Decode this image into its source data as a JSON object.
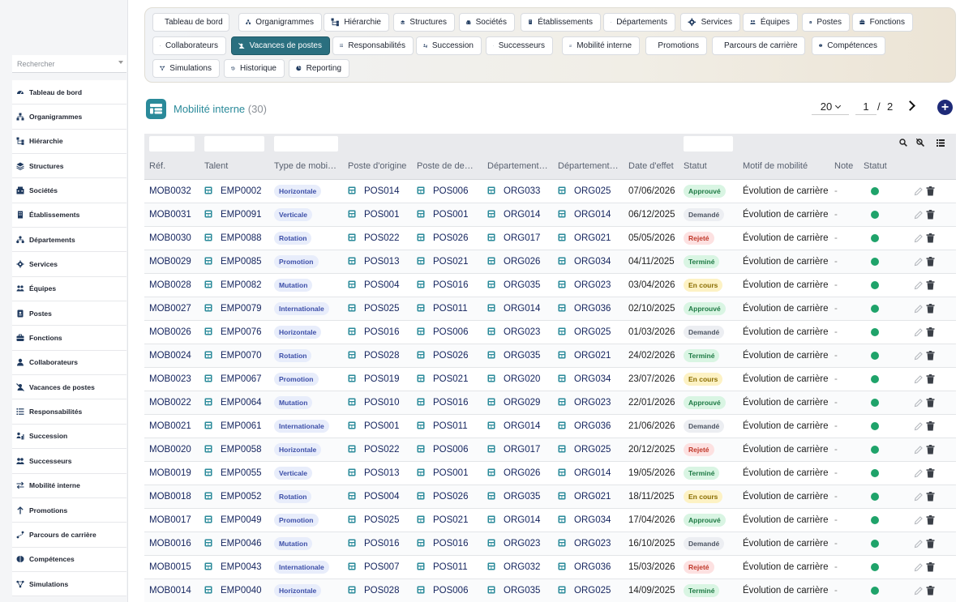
{
  "sidebar": {
    "search_placeholder": "Rechercher",
    "items": [
      {
        "label": "Tableau de bord",
        "icon": "dashboard-icon"
      },
      {
        "label": "Organigrammes",
        "icon": "org-chart-icon"
      },
      {
        "label": "Hiérarchie",
        "icon": "hierarchy-icon"
      },
      {
        "label": "Structures",
        "icon": "layers-icon"
      },
      {
        "label": "Sociétés",
        "icon": "company-icon"
      },
      {
        "label": "Établissements",
        "icon": "building-icon"
      },
      {
        "label": "Départements",
        "icon": "departments-icon"
      },
      {
        "label": "Services",
        "icon": "services-icon"
      },
      {
        "label": "Équipes",
        "icon": "teams-icon"
      },
      {
        "label": "Postes",
        "icon": "badge-icon"
      },
      {
        "label": "Fonctions",
        "icon": "briefcase-icon"
      },
      {
        "label": "Collaborateurs",
        "icon": "user-icon"
      },
      {
        "label": "Vacances de postes",
        "icon": "vacancy-icon"
      },
      {
        "label": "Responsabilités",
        "icon": "list-icon"
      },
      {
        "label": "Succession",
        "icon": "succession-icon"
      },
      {
        "label": "Successeurs",
        "icon": "successors-icon"
      },
      {
        "label": "Mobilité interne",
        "icon": "swap-icon"
      },
      {
        "label": "Promotions",
        "icon": "arrow-up-icon"
      },
      {
        "label": "Parcours de carrière",
        "icon": "career-path-icon"
      },
      {
        "label": "Compétences",
        "icon": "brain-icon"
      },
      {
        "label": "Simulations",
        "icon": "simulation-icon"
      }
    ]
  },
  "menu": {
    "active_index": 12,
    "rows": [
      [
        {
          "label": "Tableau de bord",
          "icon": "dashboard-icon"
        },
        {
          "label": "Organigrammes",
          "icon": "org-chart-icon"
        },
        {
          "label": "Hiérarchie",
          "icon": "hierarchy-icon"
        },
        {
          "label": "Structures",
          "icon": "layers-icon"
        },
        {
          "label": "Sociétés",
          "icon": "company-icon"
        },
        {
          "label": "Établissements",
          "icon": "building-icon"
        },
        {
          "label": "Départements",
          "icon": "departments-icon"
        },
        {
          "label": "Services",
          "icon": "services-icon"
        },
        {
          "label": "Équipes",
          "icon": "teams-icon"
        },
        {
          "label": "Postes",
          "icon": "badge-icon"
        },
        {
          "label": "Fonctions",
          "icon": "briefcase-icon"
        }
      ],
      [
        {
          "label": "Collaborateurs",
          "icon": "user-icon"
        },
        {
          "label": "Vacances de postes",
          "icon": "vacancy-icon"
        },
        {
          "label": "Responsabilités",
          "icon": "list-icon"
        },
        {
          "label": "Succession",
          "icon": "succession-icon"
        },
        {
          "label": "Successeurs",
          "icon": "successors-icon"
        },
        {
          "label": "Mobilité interne",
          "icon": "swap-icon"
        },
        {
          "label": "Promotions",
          "icon": "arrow-up-icon"
        },
        {
          "label": "Parcours de carrière",
          "icon": "career-path-icon"
        },
        {
          "label": "Compétences",
          "icon": "brain-icon"
        }
      ],
      [
        {
          "label": "Simulations",
          "icon": "simulation-icon"
        },
        {
          "label": "Historique",
          "icon": "history-icon"
        },
        {
          "label": "Reporting",
          "icon": "chart-icon"
        }
      ]
    ]
  },
  "header": {
    "title": "Mobilité interne",
    "count": "(30)",
    "page_size": "20",
    "page_current": "1",
    "page_separator": "/",
    "page_total": "2"
  },
  "table": {
    "columns": [
      "Réf.",
      "Talent",
      "Type de mobi…",
      "Poste d'origine",
      "Poste de de…",
      "Département…",
      "Département…",
      "Date d'effet",
      "Statut",
      "Motif de mobilité",
      "Note",
      "Statut"
    ],
    "colors": {
      "Approuvé": {
        "bg": "#d9f5e3",
        "fg": "#1f7a45"
      },
      "Demandé": {
        "bg": "#eceef2",
        "fg": "#4d5563"
      },
      "Rejeté": {
        "bg": "#fde1e1",
        "fg": "#c0392b"
      },
      "Terminé": {
        "bg": "#d9f5e3",
        "fg": "#1f7a45"
      },
      "En cours": {
        "bg": "#fdf2c4",
        "fg": "#8a6d00"
      },
      "active_dot": "#1fa36a"
    },
    "rows": [
      {
        "ref": "MOB0032",
        "talent": "EMP0002",
        "type": "Horizontale",
        "origin": "POS014",
        "dest": "POS006",
        "dep_from": "ORG033",
        "dep_to": "ORG025",
        "date": "07/06/2026",
        "status": "Approuvé",
        "reason": "Évolution de carrière",
        "note": "-"
      },
      {
        "ref": "MOB0031",
        "talent": "EMP0091",
        "type": "Verticale",
        "origin": "POS001",
        "dest": "POS001",
        "dep_from": "ORG014",
        "dep_to": "ORG014",
        "date": "06/12/2025",
        "status": "Demandé",
        "reason": "Évolution de carrière",
        "note": "-"
      },
      {
        "ref": "MOB0030",
        "talent": "EMP0088",
        "type": "Rotation",
        "origin": "POS022",
        "dest": "POS026",
        "dep_from": "ORG017",
        "dep_to": "ORG021",
        "date": "05/05/2026",
        "status": "Rejeté",
        "reason": "Évolution de carrière",
        "note": "-"
      },
      {
        "ref": "MOB0029",
        "talent": "EMP0085",
        "type": "Promotion",
        "origin": "POS013",
        "dest": "POS021",
        "dep_from": "ORG026",
        "dep_to": "ORG034",
        "date": "04/11/2025",
        "status": "Terminé",
        "reason": "Évolution de carrière",
        "note": "-"
      },
      {
        "ref": "MOB0028",
        "talent": "EMP0082",
        "type": "Mutation",
        "origin": "POS004",
        "dest": "POS016",
        "dep_from": "ORG035",
        "dep_to": "ORG023",
        "date": "03/04/2026",
        "status": "En cours",
        "reason": "Évolution de carrière",
        "note": "-"
      },
      {
        "ref": "MOB0027",
        "talent": "EMP0079",
        "type": "Internationale",
        "origin": "POS025",
        "dest": "POS011",
        "dep_from": "ORG014",
        "dep_to": "ORG036",
        "date": "02/10/2025",
        "status": "Approuvé",
        "reason": "Évolution de carrière",
        "note": "-"
      },
      {
        "ref": "MOB0026",
        "talent": "EMP0076",
        "type": "Horizontale",
        "origin": "POS016",
        "dest": "POS006",
        "dep_from": "ORG023",
        "dep_to": "ORG025",
        "date": "01/03/2026",
        "status": "Demandé",
        "reason": "Évolution de carrière",
        "note": "-"
      },
      {
        "ref": "MOB0024",
        "talent": "EMP0070",
        "type": "Rotation",
        "origin": "POS028",
        "dest": "POS026",
        "dep_from": "ORG035",
        "dep_to": "ORG021",
        "date": "24/02/2026",
        "status": "Terminé",
        "reason": "Évolution de carrière",
        "note": "-"
      },
      {
        "ref": "MOB0023",
        "talent": "EMP0067",
        "type": "Promotion",
        "origin": "POS019",
        "dest": "POS021",
        "dep_from": "ORG020",
        "dep_to": "ORG034",
        "date": "23/07/2026",
        "status": "En cours",
        "reason": "Évolution de carrière",
        "note": "-"
      },
      {
        "ref": "MOB0022",
        "talent": "EMP0064",
        "type": "Mutation",
        "origin": "POS010",
        "dest": "POS016",
        "dep_from": "ORG029",
        "dep_to": "ORG023",
        "date": "22/01/2026",
        "status": "Approuvé",
        "reason": "Évolution de carrière",
        "note": "-"
      },
      {
        "ref": "MOB0021",
        "talent": "EMP0061",
        "type": "Internationale",
        "origin": "POS001",
        "dest": "POS011",
        "dep_from": "ORG014",
        "dep_to": "ORG036",
        "date": "21/06/2026",
        "status": "Demandé",
        "reason": "Évolution de carrière",
        "note": "-"
      },
      {
        "ref": "MOB0020",
        "talent": "EMP0058",
        "type": "Horizontale",
        "origin": "POS022",
        "dest": "POS006",
        "dep_from": "ORG017",
        "dep_to": "ORG025",
        "date": "20/12/2025",
        "status": "Rejeté",
        "reason": "Évolution de carrière",
        "note": "-"
      },
      {
        "ref": "MOB0019",
        "talent": "EMP0055",
        "type": "Verticale",
        "origin": "POS013",
        "dest": "POS001",
        "dep_from": "ORG026",
        "dep_to": "ORG014",
        "date": "19/05/2026",
        "status": "Terminé",
        "reason": "Évolution de carrière",
        "note": "-"
      },
      {
        "ref": "MOB0018",
        "talent": "EMP0052",
        "type": "Rotation",
        "origin": "POS004",
        "dest": "POS026",
        "dep_from": "ORG035",
        "dep_to": "ORG021",
        "date": "18/11/2025",
        "status": "En cours",
        "reason": "Évolution de carrière",
        "note": "-"
      },
      {
        "ref": "MOB0017",
        "talent": "EMP0049",
        "type": "Promotion",
        "origin": "POS025",
        "dest": "POS021",
        "dep_from": "ORG014",
        "dep_to": "ORG034",
        "date": "17/04/2026",
        "status": "Approuvé",
        "reason": "Évolution de carrière",
        "note": "-"
      },
      {
        "ref": "MOB0016",
        "talent": "EMP0046",
        "type": "Mutation",
        "origin": "POS016",
        "dest": "POS016",
        "dep_from": "ORG023",
        "dep_to": "ORG023",
        "date": "16/10/2025",
        "status": "Demandé",
        "reason": "Évolution de carrière",
        "note": "-"
      },
      {
        "ref": "MOB0015",
        "talent": "EMP0043",
        "type": "Internationale",
        "origin": "POS007",
        "dest": "POS011",
        "dep_from": "ORG032",
        "dep_to": "ORG036",
        "date": "15/03/2026",
        "status": "Rejeté",
        "reason": "Évolution de carrière",
        "note": "-"
      },
      {
        "ref": "MOB0014",
        "talent": "EMP0040",
        "type": "Horizontale",
        "origin": "POS028",
        "dest": "POS006",
        "dep_from": "ORG035",
        "dep_to": "ORG025",
        "date": "14/09/2025",
        "status": "Terminé",
        "reason": "Évolution de carrière",
        "note": "-"
      }
    ]
  }
}
